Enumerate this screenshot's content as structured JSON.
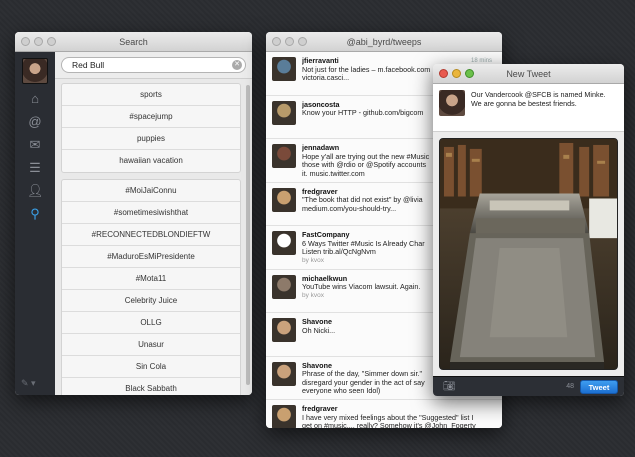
{
  "search_window": {
    "title": "Search",
    "query": "Red Bull",
    "saved_searches": [
      "sports",
      "#spacejump",
      "puppies",
      "hawaiian vacation"
    ],
    "trends": [
      "#MoiJaiConnu",
      "#sometimesiwishthat",
      "#RECONNECTEDBLONDIEFTW",
      "#MaduroEsMiPresidente",
      "#Mota11",
      "Celebrity Juice",
      "OLLG",
      "Unasur",
      "Sin Cola",
      "Black Sabbath"
    ],
    "nav_icons": [
      "home-icon",
      "mentions-icon",
      "messages-icon",
      "lists-icon",
      "profile-icon",
      "search-icon"
    ]
  },
  "tweets_window": {
    "title": "@abi_byrd/tweeps",
    "time": "18 mins",
    "tweets": [
      {
        "user": "jfierravanti",
        "lines": [
          "Not just for the ladies – m.facebook.com",
          "victoria.casci..."
        ],
        "color": "#5a7d99"
      },
      {
        "user": "jasoncosta",
        "lines": [
          "Know your HTTP - github.com/bigcom"
        ],
        "color": "#b79a6a"
      },
      {
        "user": "jennadawn",
        "lines": [
          "Hope y'all are trying out the new #Music",
          "those with @rdio or @Spotify accounts",
          "it. music.twitter.com"
        ],
        "color": "#7a4a3a"
      },
      {
        "user": "fredgraver",
        "lines": [
          "\"The book that did not exist\" by @livia",
          "medium.com/you-should-try..."
        ],
        "color": "#c9a070"
      },
      {
        "user": "FastCompany",
        "lines": [
          "6 Ways Twitter #Music Is Already Char",
          "Listen trib.al/QcNgNvm",
          "by kvox"
        ],
        "color": "#ffffff"
      },
      {
        "user": "michaelkwun",
        "lines": [
          "YouTube wins Viacom lawsuit. Again.",
          "by kvox"
        ],
        "color": "#8d7a6a"
      },
      {
        "user": "Shavone",
        "lines": [
          "Oh Nicki..."
        ],
        "color": "#caa27c"
      },
      {
        "user": "Shavone",
        "lines": [
          "Phrase of the day, \"Simmer down sir.\"",
          "disregard your gender in the act of say",
          "everyone who seen Idol)"
        ],
        "color": "#caa27c"
      },
      {
        "user": "fredgraver",
        "lines": [
          "I have very mixed feelings about the \"Suggested\" list I",
          "get on #music..., really? Somehow it's @John_Fogerty",
          "and @katyperry ????"
        ],
        "color": "#c9a070"
      }
    ]
  },
  "new_tweet_window": {
    "title": "New Tweet",
    "text": "Our Vandercook @SFCB  is named Minke. We are gonna be bestest friends.",
    "char_count": "48",
    "tweet_button": "Tweet"
  }
}
